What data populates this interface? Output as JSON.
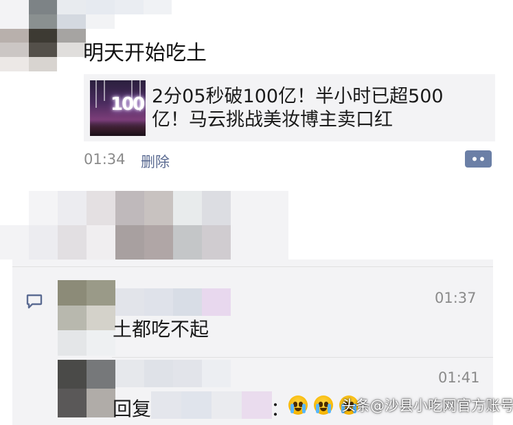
{
  "post": {
    "text": "明天开始吃土",
    "time": "01:34",
    "delete_label": "删除",
    "more_icon": "more-dots-icon"
  },
  "link_card": {
    "title": "2分05秒破100亿！半小时已超500亿！马云挑战美妆博主卖口红",
    "thumbnail_text": "100"
  },
  "comments": [
    {
      "time": "01:37",
      "text": "土都吃不起"
    },
    {
      "time": "01:41",
      "prefix": "回复",
      "separator": "：",
      "emojis": [
        "crying-face-emoji",
        "crying-face-emoji",
        "crying-face-emoji"
      ]
    }
  ],
  "comment_icon": "comment-bubble-icon",
  "watermark": "头条@沙县小吃网官方账号",
  "colors": {
    "link_blue": "#5b6b92",
    "comment_bg": "#f3f3f5",
    "time_gray": "#8a8a8a"
  }
}
